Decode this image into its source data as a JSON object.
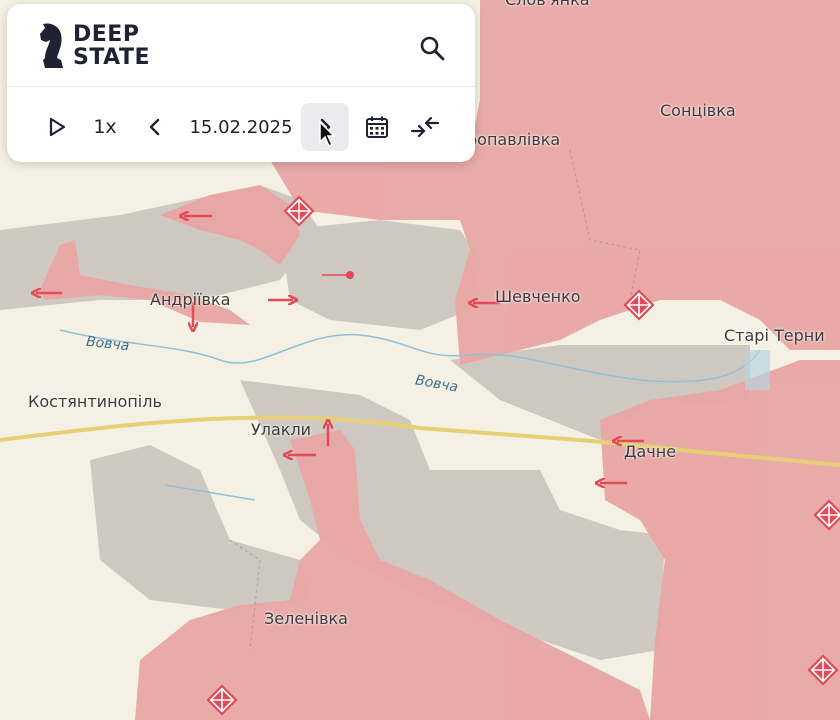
{
  "app": {
    "logo_line1": "DEEP",
    "logo_line2": "STATE"
  },
  "timeline": {
    "speed": "1x",
    "date": "15.02.2025"
  },
  "places": {
    "top_cut": "Слов'янка",
    "petropavlivka": "ропавлівка",
    "sontsivka": "Сонцівка",
    "andriivka": "Андріївка",
    "shevchenko": "Шевченко",
    "stari_terny": "Старі Терни",
    "kostiantynopil": "Костянтинопіль",
    "ulakly": "Улакли",
    "dachne": "Дачне",
    "zelenivka": "Зеленівка"
  },
  "rivers": {
    "vovcha_1": "Вовча",
    "vovcha_2": "Вовча"
  },
  "colors": {
    "occupied": "#e8a6a4",
    "contested": "#c8c1bb",
    "liberated": "#fbf6e6",
    "arrow": "#e24a57",
    "river": "#7fb7d4",
    "road": "#e8cf77",
    "panel_bg": "#ffffff",
    "panel_text": "#1f2233"
  },
  "icons": [
    "play-icon",
    "chevron-left-icon",
    "chevron-right-icon",
    "calendar-icon",
    "compare-icon",
    "search-icon",
    "knight-logo-icon",
    "attack-arrow-icon",
    "fortification-icon",
    "cursor-icon"
  ]
}
